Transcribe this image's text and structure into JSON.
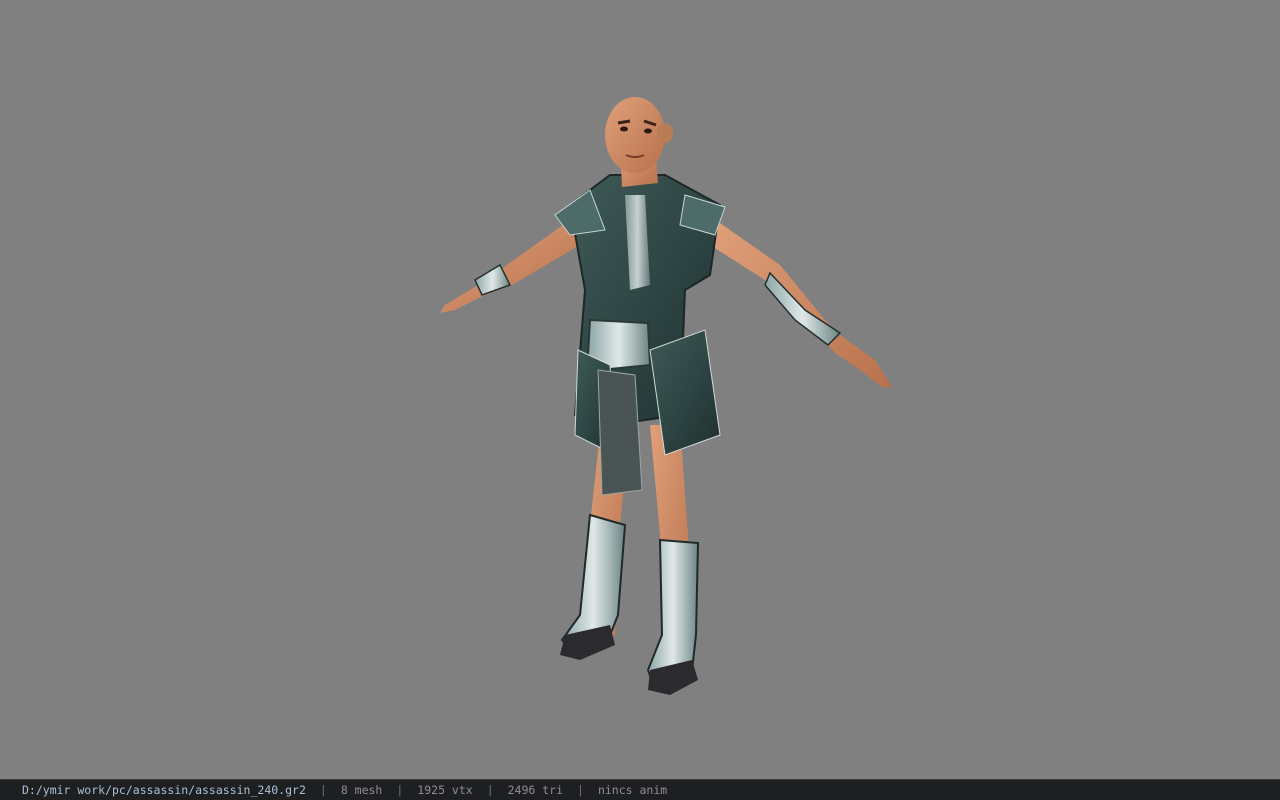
{
  "viewer": {
    "background_color": "#808080",
    "model_name": "assassin character model"
  },
  "status_bar": {
    "file_path": "D:/ymir work/pc/assassin/assassin_240.gr2",
    "separator": "|",
    "mesh_count": "8 mesh",
    "vertex_count": "1925 vtx",
    "triangle_count": "2496 tri",
    "animation": "nincs anim"
  }
}
